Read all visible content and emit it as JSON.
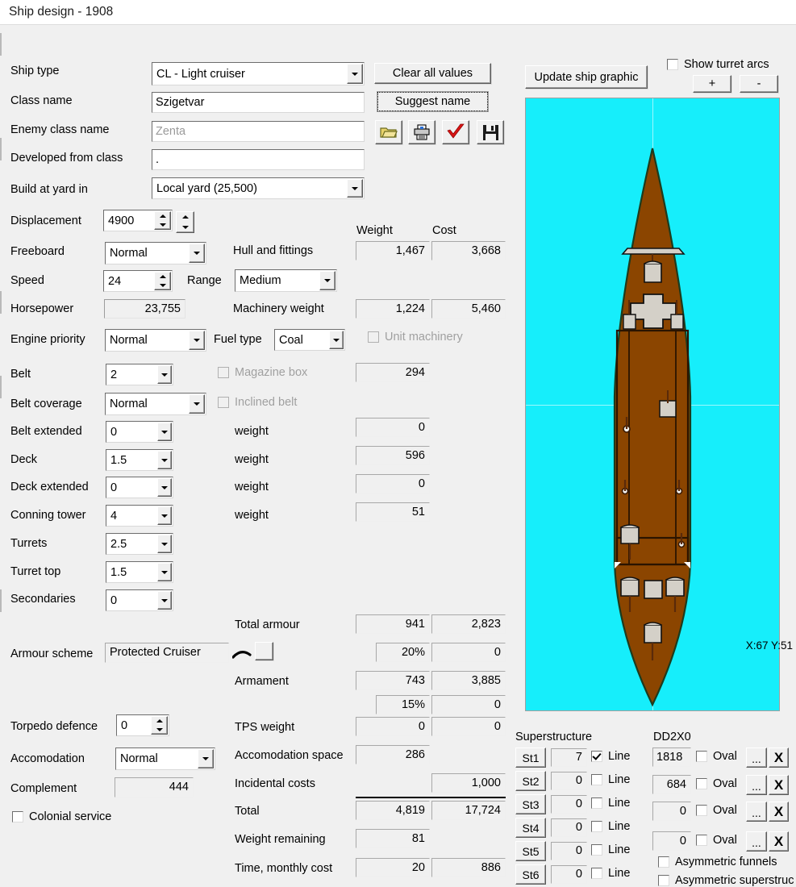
{
  "window": {
    "title": "Ship design - 1908"
  },
  "left_form": {
    "ship_type": {
      "label": "Ship type",
      "value": "CL - Light cruiser"
    },
    "class_name": {
      "label": "Class name",
      "value": "Szigetvar"
    },
    "enemy_class_name": {
      "label": "Enemy class name",
      "value": "Zenta"
    },
    "developed_from": {
      "label": "Developed from class",
      "value": "."
    },
    "build_at_yard": {
      "label": "Build at yard in",
      "value": "Local yard (25,500)"
    },
    "displacement": {
      "label": "Displacement",
      "value": "4900"
    },
    "freeboard": {
      "label": "Freeboard",
      "value": "Normal"
    },
    "speed": {
      "label": "Speed",
      "value": "24"
    },
    "range": {
      "label": "Range",
      "value": "Medium"
    },
    "horsepower": {
      "label": "Horsepower",
      "value": "23,755"
    },
    "engine_priority": {
      "label": "Engine priority",
      "value": "Normal"
    },
    "fuel_type": {
      "label": "Fuel type",
      "value": "Coal"
    },
    "belt": {
      "label": "Belt",
      "value": "2"
    },
    "belt_coverage": {
      "label": "Belt coverage",
      "value": "Normal"
    },
    "belt_extended": {
      "label": "Belt extended",
      "value": "0"
    },
    "deck": {
      "label": "Deck",
      "value": "1.5"
    },
    "deck_extended": {
      "label": "Deck extended",
      "value": "0"
    },
    "conning_tower": {
      "label": "Conning tower",
      "value": "4"
    },
    "turrets": {
      "label": "Turrets",
      "value": "2.5"
    },
    "turret_top": {
      "label": "Turret top",
      "value": "1.5"
    },
    "secondaries": {
      "label": "Secondaries",
      "value": "0"
    },
    "armour_scheme": {
      "label": "Armour scheme",
      "value": "Protected Cruiser"
    },
    "torpedo_defence": {
      "label": "Torpedo defence",
      "value": "0"
    },
    "accomodation": {
      "label": "Accomodation",
      "value": "Normal"
    },
    "complement": {
      "label": "Complement",
      "value": "444"
    },
    "colonial_service": {
      "label": "Colonial service",
      "checked": false
    }
  },
  "checkboxes": {
    "magazine_box": {
      "label": "Magazine box",
      "checked": false,
      "disabled": true
    },
    "inclined_belt": {
      "label": "Inclined belt",
      "checked": false,
      "disabled": true
    },
    "unit_machinery": {
      "label": "Unit machinery",
      "checked": false,
      "disabled": true
    }
  },
  "buttons": {
    "clear_all_values": "Clear all values",
    "suggest_name": "Suggest name",
    "update_ship_graphic": "Update ship graphic",
    "plus": "+",
    "minus": "-"
  },
  "icons": {
    "open": "open-folder-icon",
    "print": "printer-icon",
    "accept": "red-check-icon",
    "save": "floppy-disk-icon"
  },
  "turret_arcs": {
    "label": "Show turret arcs",
    "checked": false
  },
  "weights": {
    "col_weight": "Weight",
    "col_cost": "Cost",
    "rows": [
      {
        "label": "Hull and fittings",
        "weight": "1,467",
        "cost": "3,668"
      },
      {
        "label": "Machinery weight",
        "weight": "1,224",
        "cost": "5,460"
      },
      {
        "label": "",
        "weight": "294",
        "cost": ""
      },
      {
        "label": "weight",
        "weight": "0",
        "cost": ""
      },
      {
        "label": "weight",
        "weight": "596",
        "cost": ""
      },
      {
        "label": "weight",
        "weight": "0",
        "cost": ""
      },
      {
        "label": "weight",
        "weight": "51",
        "cost": ""
      },
      {
        "label": "Total armour",
        "weight": "941",
        "cost": "2,823"
      },
      {
        "label": "",
        "weight": "20%",
        "cost": "0"
      },
      {
        "label": "Armament",
        "weight": "743",
        "cost": "3,885"
      },
      {
        "label": "",
        "weight": "15%",
        "cost": "0"
      },
      {
        "label": "TPS weight",
        "weight": "0",
        "cost": "0"
      },
      {
        "label": "Accomodation space",
        "weight": "286",
        "cost": ""
      },
      {
        "label": "Incidental costs",
        "weight": "",
        "cost": "1,000"
      },
      {
        "label": "Total",
        "weight": "4,819",
        "cost": "17,724"
      },
      {
        "label": "Weight remaining",
        "weight": "81",
        "cost": ""
      },
      {
        "label": "Time, monthly cost",
        "weight": "20",
        "cost": "886"
      }
    ]
  },
  "ship_graphic": {
    "coords": "X:67 Y:51",
    "sea_color": "#16eefb",
    "hull_color": "#8b4500",
    "fitting_color": "#d4d0c8"
  },
  "superstructure": {
    "title": "Superstructure",
    "rows": [
      {
        "button": "St1",
        "value": "7",
        "line_label": "Line",
        "line_checked": true
      },
      {
        "button": "St2",
        "value": "0",
        "line_label": "Line",
        "line_checked": false
      },
      {
        "button": "St3",
        "value": "0",
        "line_label": "Line",
        "line_checked": false
      },
      {
        "button": "St4",
        "value": "0",
        "line_label": "Line",
        "line_checked": false
      },
      {
        "button": "St5",
        "value": "0",
        "line_label": "Line",
        "line_checked": false
      },
      {
        "button": "St6",
        "value": "0",
        "line_label": "Line",
        "line_checked": false
      }
    ]
  },
  "funnels": {
    "title": "DD2X0",
    "rows": [
      {
        "value": "1818",
        "oval_label": "Oval",
        "oval_checked": false,
        "edit": "...",
        "remove": "X"
      },
      {
        "value": "684",
        "oval_label": "Oval",
        "oval_checked": false,
        "edit": "...",
        "remove": "X"
      },
      {
        "value": "0",
        "oval_label": "Oval",
        "oval_checked": false,
        "edit": "...",
        "remove": "X"
      },
      {
        "value": "0",
        "oval_label": "Oval",
        "oval_checked": false,
        "edit": "...",
        "remove": "X"
      }
    ],
    "asym_funnels": {
      "label": "Asymmetric funnels",
      "checked": false
    },
    "asym_superstructure": {
      "label": "Asymmetric superstruc",
      "checked": false
    }
  }
}
